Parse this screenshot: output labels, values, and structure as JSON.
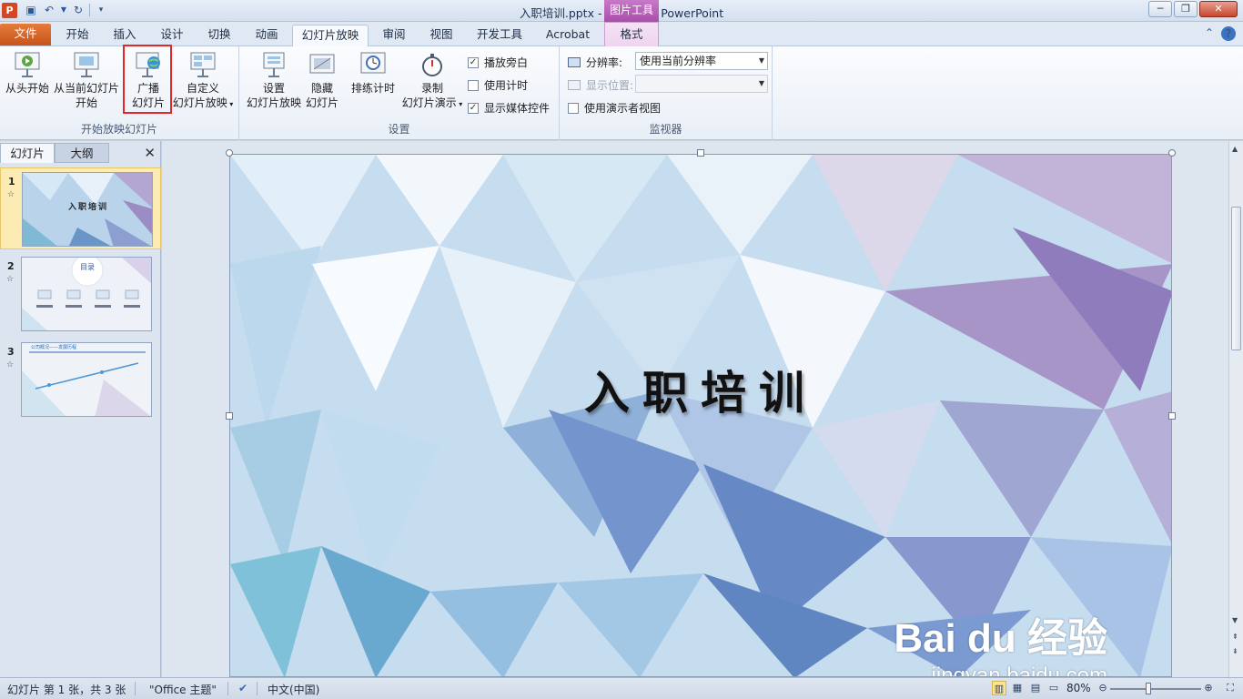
{
  "window": {
    "title": "入职培训.pptx - Microsoft PowerPoint",
    "contextual_tab_group": "图片工具",
    "app_icon": "P"
  },
  "tabs": {
    "file": "文件",
    "items": [
      "开始",
      "插入",
      "设计",
      "切换",
      "动画",
      "幻灯片放映",
      "审阅",
      "视图",
      "开发工具",
      "Acrobat"
    ],
    "active": "幻灯片放映",
    "format": "格式"
  },
  "ribbon": {
    "group1": {
      "label": "开始放映幻灯片",
      "from_start": "从头开始",
      "from_current_1": "从当前幻灯片",
      "from_current_2": "开始",
      "broadcast_1": "广播",
      "broadcast_2": "幻灯片",
      "custom_1": "自定义",
      "custom_2": "幻灯片放映"
    },
    "group2": {
      "label": "设置",
      "setup_1": "设置",
      "setup_2": "幻灯片放映",
      "hide_1": "隐藏",
      "hide_2": "幻灯片",
      "rehearse": "排练计时",
      "record_1": "录制",
      "record_2": "幻灯片演示",
      "play_narrations": "播放旁白",
      "use_timings": "使用计时",
      "show_media_controls": "显示媒体控件",
      "play_narrations_checked": true,
      "use_timings_checked": false,
      "show_media_controls_checked": true
    },
    "group3": {
      "label": "监视器",
      "resolution_label": "分辨率:",
      "resolution_value": "使用当前分辨率",
      "display_label": "显示位置:",
      "display_value": "",
      "presenter_view": "使用演示者视图",
      "presenter_view_checked": false
    }
  },
  "slides_panel": {
    "tab_slides": "幻灯片",
    "tab_outline": "大纲",
    "close": "✕",
    "thumbs": [
      {
        "num": "1",
        "title": "入职培训"
      },
      {
        "num": "2",
        "title": "目录"
      },
      {
        "num": "3",
        "title": "公司概况——发展历程"
      }
    ]
  },
  "slide": {
    "title": "入职培训"
  },
  "watermark": {
    "brand": "Bai du 经验",
    "url": "jingyan.baidu.com"
  },
  "statusbar": {
    "slide_info": "幻灯片 第 1 张，共 3 张",
    "theme": "\"Office 主题\"",
    "language": "中文(中国)",
    "zoom": "80%"
  },
  "colors": {
    "file_tab": "#d2571f",
    "highlight_box": "#e2262b",
    "contextual": "#b65bb6",
    "selected_thumb": "#fcecb4"
  }
}
